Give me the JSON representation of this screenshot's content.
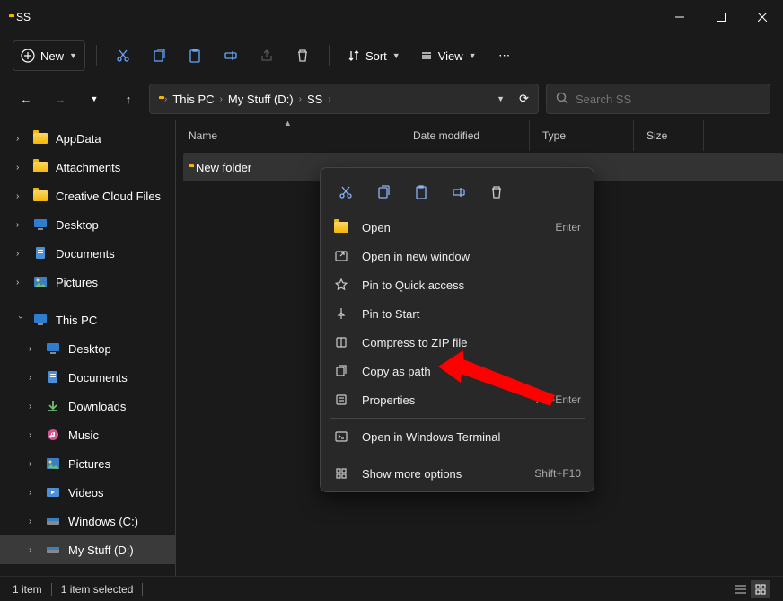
{
  "window": {
    "title": "SS"
  },
  "toolbar": {
    "new": "New",
    "sort": "Sort",
    "view": "View"
  },
  "breadcrumb": {
    "parts": [
      "This PC",
      "My Stuff (D:)",
      "SS"
    ]
  },
  "search": {
    "placeholder": "Search SS"
  },
  "columns": {
    "name": "Name",
    "date": "Date modified",
    "type": "Type",
    "size": "Size"
  },
  "file_list": {
    "rows": [
      {
        "name": "New folder"
      }
    ]
  },
  "sidebar": {
    "items": [
      {
        "label": "AppData",
        "icon": "folder"
      },
      {
        "label": "Attachments",
        "icon": "folder"
      },
      {
        "label": "Creative Cloud Files",
        "icon": "folder"
      },
      {
        "label": "Desktop",
        "icon": "desktop"
      },
      {
        "label": "Documents",
        "icon": "documents"
      },
      {
        "label": "Pictures",
        "icon": "pictures"
      }
    ],
    "thispc": {
      "label": "This PC"
    },
    "thispc_children": [
      {
        "label": "Desktop",
        "icon": "desktop"
      },
      {
        "label": "Documents",
        "icon": "documents"
      },
      {
        "label": "Downloads",
        "icon": "downloads"
      },
      {
        "label": "Music",
        "icon": "music"
      },
      {
        "label": "Pictures",
        "icon": "pictures"
      },
      {
        "label": "Videos",
        "icon": "videos"
      },
      {
        "label": "Windows (C:)",
        "icon": "drive"
      },
      {
        "label": "My Stuff (D:)",
        "icon": "drive"
      }
    ]
  },
  "context_menu": {
    "open": "Open",
    "open_short": "Enter",
    "open_new": "Open in new window",
    "pin_qa": "Pin to Quick access",
    "pin_start": "Pin to Start",
    "zip": "Compress to ZIP file",
    "copy_path": "Copy as path",
    "properties": "Properties",
    "prop_short": "Alt+Enter",
    "terminal": "Open in Windows Terminal",
    "more": "Show more options",
    "more_short": "Shift+F10"
  },
  "status": {
    "count": "1 item",
    "selected": "1 item selected"
  }
}
